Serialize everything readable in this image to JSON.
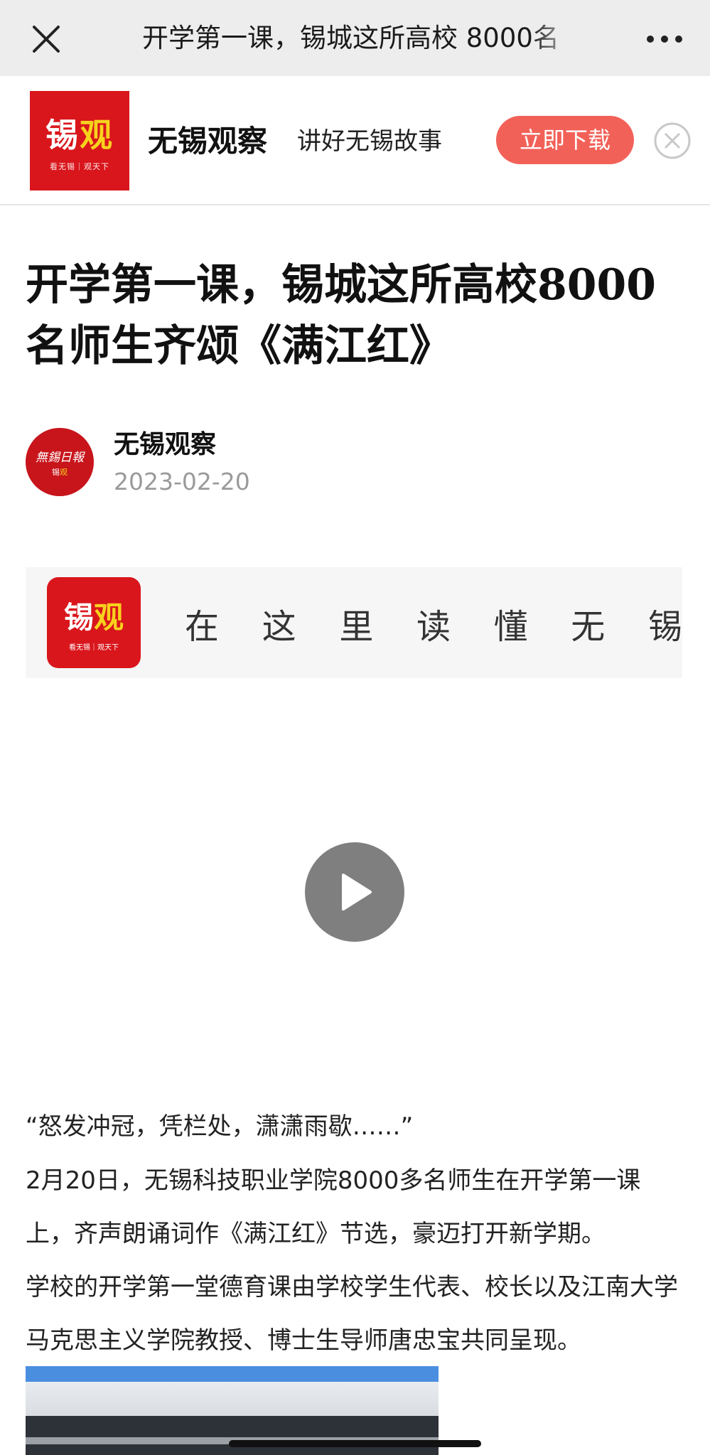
{
  "nav": {
    "title": "开学第一课，锡城这所高校 8000名",
    "close_icon": "close-icon",
    "more_icon": "more-icon"
  },
  "app_banner": {
    "logo_text_white": "锡",
    "logo_text_yellow": "观",
    "logo_small": "看无锡｜观天下",
    "app_name": "无锡观察",
    "slogan": "讲好无锡故事",
    "download_label": "立即下载",
    "colors": {
      "logo_bg": "#d9161c",
      "button_bg": "#f26158",
      "logo_accent": "#f7d21d"
    }
  },
  "article": {
    "headline": "开学第一课，锡城这所高校8000名师生齐颂《满江红》",
    "author": {
      "name": "无锡观察",
      "date": "2023-02-20",
      "avatar_line1": "無錫日報",
      "avatar_line2_white": "锡",
      "avatar_line2_yellow": "观"
    },
    "video": {
      "logo_text_white": "锡",
      "logo_text_yellow": "观",
      "logo_small": "看无锡｜观天下",
      "slogan_chars": [
        "在",
        "这",
        "里",
        "读",
        "懂",
        "无",
        "锡"
      ],
      "play_icon": "play-icon"
    },
    "quote": "“怒发冲冠，凭栏处，潇潇雨歇……”",
    "paragraph1": "2月20日，无锡科技职业学院8000多名师生在开学第一课上，齐声朗诵词作《满江红》节选，豪迈打开新学期。",
    "paragraph2": "学校的开学第一堂德育课由学校学生代表、校长以及江南大学马克思主义学院教授、博士生导师唐忠宝共同呈现。"
  }
}
